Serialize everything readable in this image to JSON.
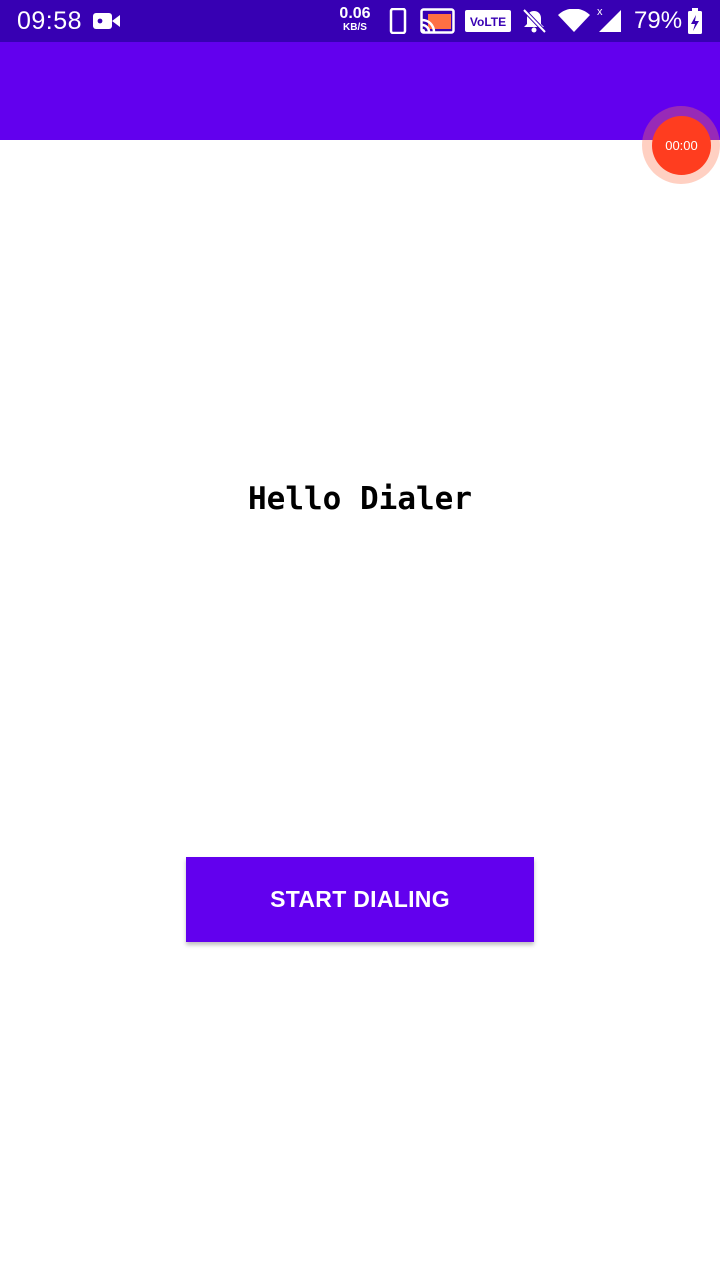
{
  "status_bar": {
    "time": "09:58",
    "net_speed_value": "0.06",
    "net_speed_unit": "KB/S",
    "volte_label": "VoLTE",
    "battery_percent": "79%",
    "icons": [
      "video-camera-icon",
      "phone-icon",
      "cast-icon",
      "volte-icon",
      "bell-off-icon",
      "wifi-icon",
      "signal-icon",
      "battery-charging-icon"
    ]
  },
  "floating_timer": {
    "label": "00:00"
  },
  "main": {
    "greeting": "Hello Dialer",
    "start_button_label": "START DIALING"
  },
  "colors": {
    "status_bar": "#3700b3",
    "app_bar": "#6200ee",
    "button": "#6200ee",
    "timer": "#ff3d1f"
  }
}
